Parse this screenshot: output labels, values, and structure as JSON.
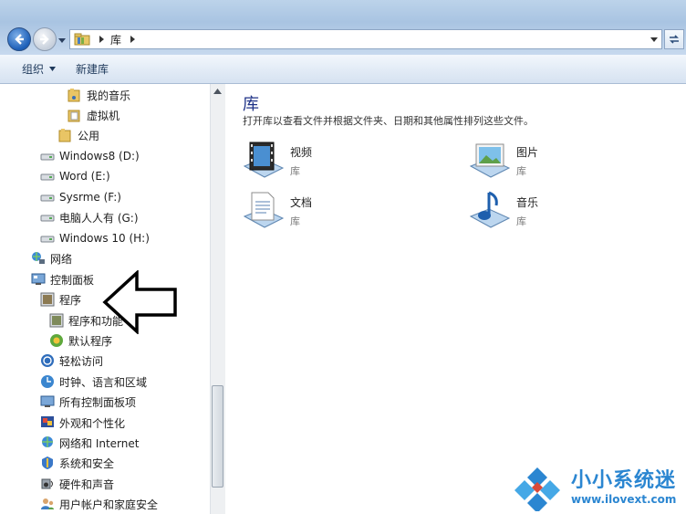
{
  "address_bar": {
    "crumbs": [
      "库"
    ]
  },
  "toolbar": {
    "organize_label": "组织",
    "new_library_label": "新建库"
  },
  "sidebar": {
    "items": [
      {
        "label": "我的音乐",
        "icon": "folder-music-icon"
      },
      {
        "label": "虚拟机",
        "icon": "folder-icon"
      },
      {
        "label": "公用",
        "icon": "folder-icon"
      },
      {
        "label": "Windows8 (D:)",
        "icon": "drive-icon"
      },
      {
        "label": "Word (E:)",
        "icon": "drive-icon"
      },
      {
        "label": "Sysrme (F:)",
        "icon": "drive-icon"
      },
      {
        "label": "电脑人人有 (G:)",
        "icon": "drive-icon"
      },
      {
        "label": "Windows 10 (H:)",
        "icon": "drive-icon"
      },
      {
        "label": "网络",
        "icon": "network-icon"
      },
      {
        "label": "控制面板",
        "icon": "control-panel-icon"
      },
      {
        "label": "程序",
        "icon": "programs-icon"
      },
      {
        "label": "程序和功能",
        "icon": "programs-features-icon"
      },
      {
        "label": "默认程序",
        "icon": "default-programs-icon"
      },
      {
        "label": "轻松访问",
        "icon": "ease-of-access-icon"
      },
      {
        "label": "时钟、语言和区域",
        "icon": "clock-language-icon"
      },
      {
        "label": "所有控制面板项",
        "icon": "all-cp-items-icon"
      },
      {
        "label": "外观和个性化",
        "icon": "appearance-icon"
      },
      {
        "label": "网络和 Internet",
        "icon": "network-internet-icon"
      },
      {
        "label": "系统和安全",
        "icon": "system-security-icon"
      },
      {
        "label": "硬件和声音",
        "icon": "hardware-sound-icon"
      },
      {
        "label": "用户帐户和家庭安全",
        "icon": "user-accounts-icon"
      }
    ]
  },
  "main": {
    "title": "库",
    "description": "打开库以查看文件并根据文件夹、日期和其他属性排列这些文件。",
    "libraries": [
      {
        "name": "视频",
        "type": "库",
        "icon": "video-library-icon"
      },
      {
        "name": "图片",
        "type": "库",
        "icon": "pictures-library-icon"
      },
      {
        "name": "文档",
        "type": "库",
        "icon": "documents-library-icon"
      },
      {
        "name": "音乐",
        "type": "库",
        "icon": "music-library-icon"
      }
    ]
  },
  "watermark": {
    "title": "小小系统迷",
    "url": "www.ilovext.com"
  },
  "colors": {
    "title_blue": "#1e3287",
    "watermark_blue": "#2b86d1",
    "toolbar_text": "#1e395b"
  }
}
